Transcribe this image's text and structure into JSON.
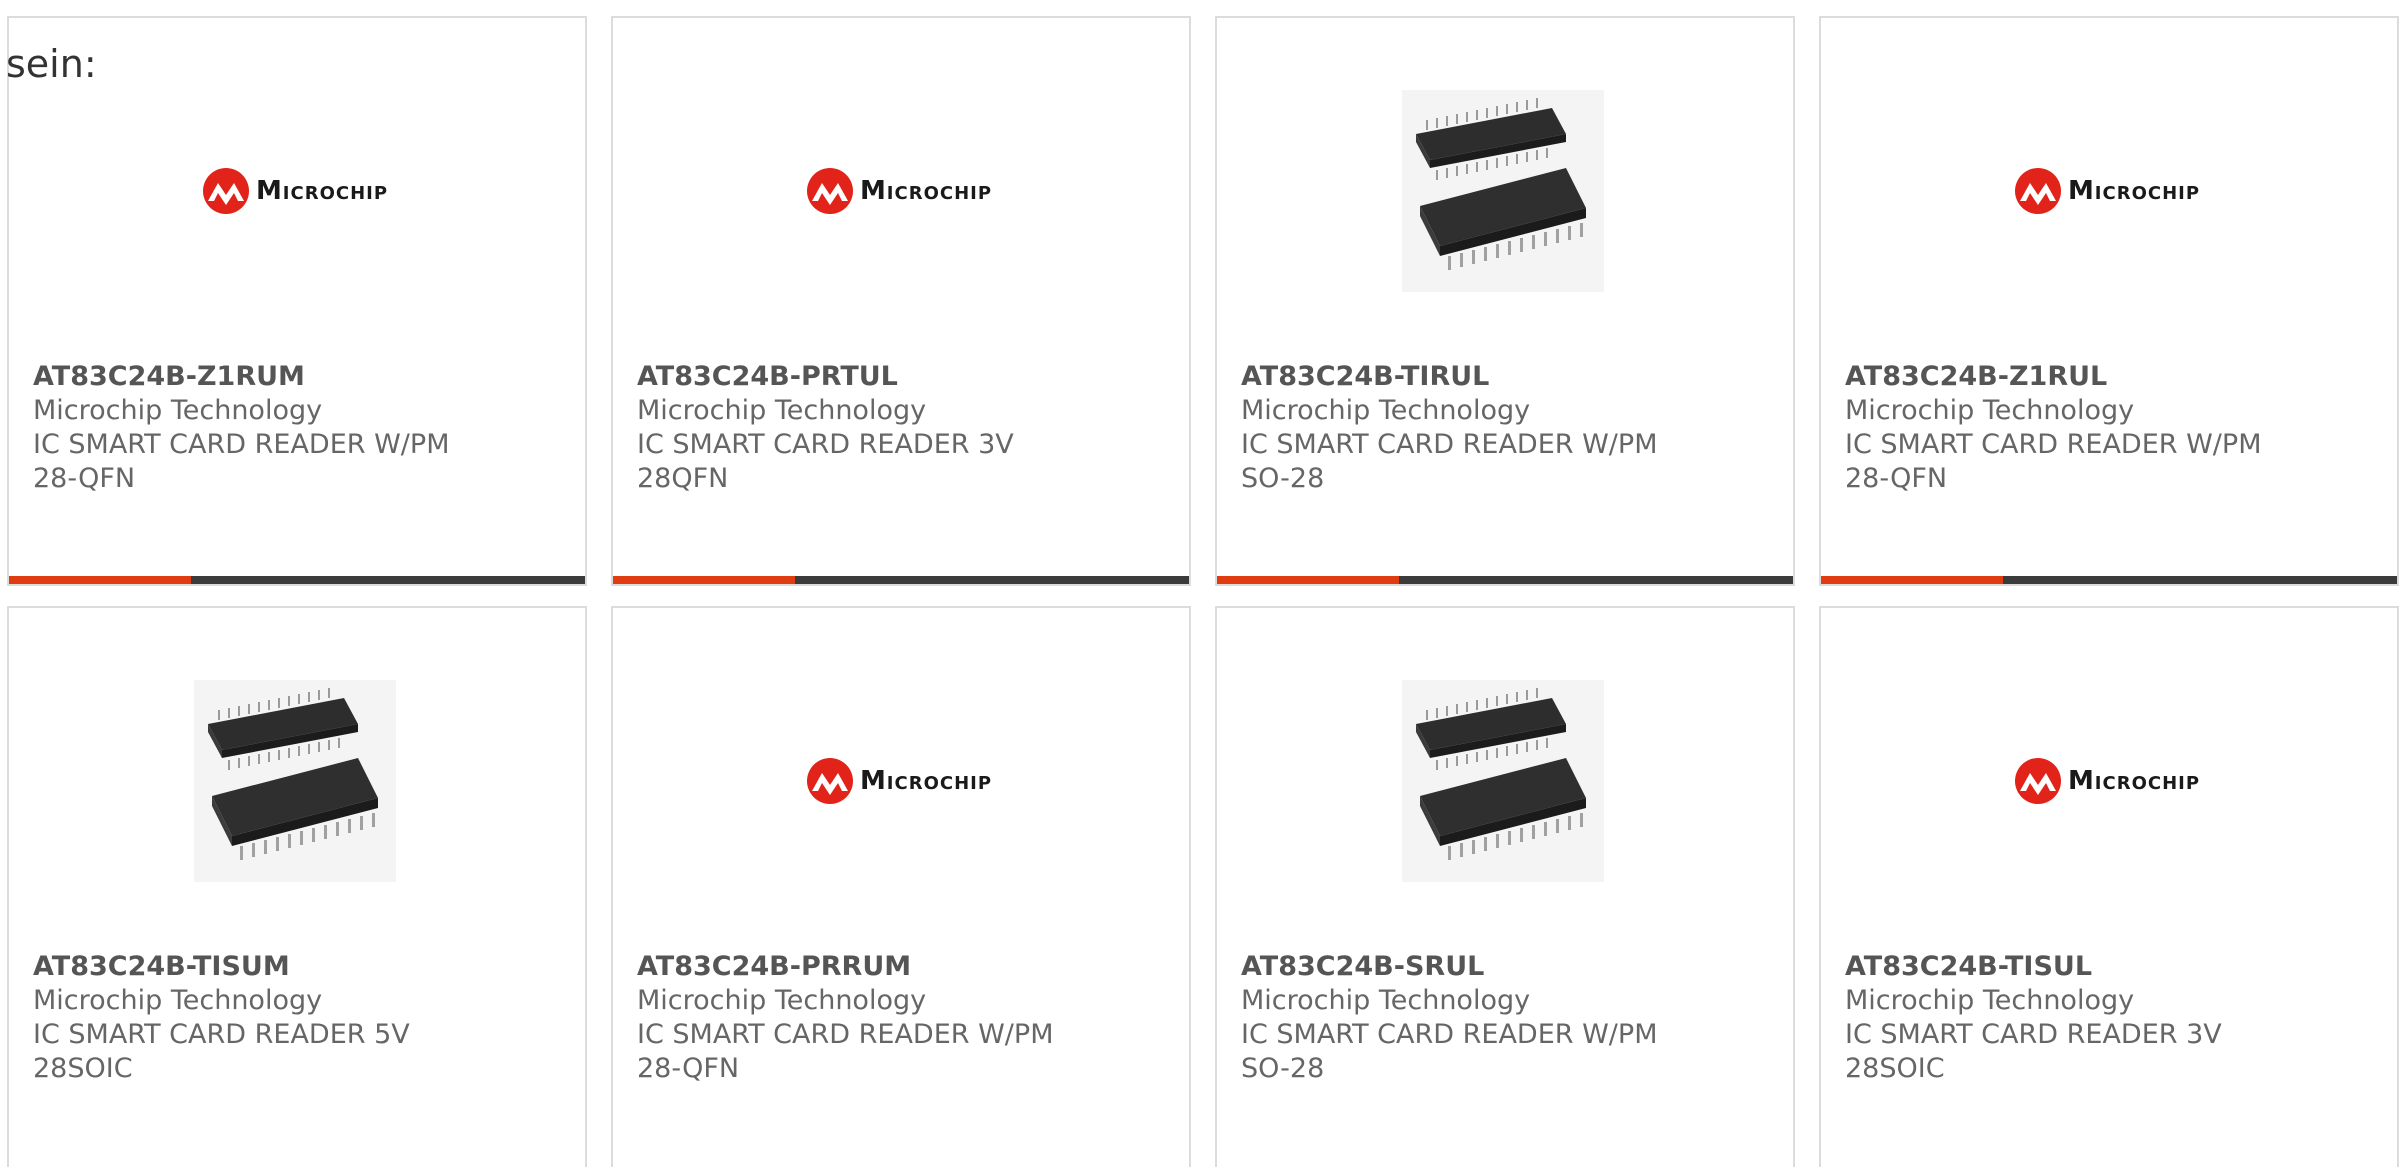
{
  "lead_text": "sein:",
  "logo_text": "Microchip",
  "colors": {
    "accent_bar": "#e03c12",
    "bar": "#3b3b3b",
    "logo_red": "#e2231a"
  },
  "cards": [
    {
      "part": "AT83C24B-Z1RUM",
      "manufacturer": "Microchip Technology",
      "description": "IC SMART CARD READER W/PM",
      "package": "28-QFN",
      "image": "microchip-logo"
    },
    {
      "part": "AT83C24B-PRTUL",
      "manufacturer": "Microchip Technology",
      "description": "IC SMART CARD READER 3V",
      "package": "28QFN",
      "image": "microchip-logo"
    },
    {
      "part": "AT83C24B-TIRUL",
      "manufacturer": "Microchip Technology",
      "description": "IC SMART CARD READER W/PM",
      "package": "SO-28",
      "image": "soic-chip"
    },
    {
      "part": "AT83C24B-Z1RUL",
      "manufacturer": "Microchip Technology",
      "description": "IC SMART CARD READER W/PM",
      "package": "28-QFN",
      "image": "microchip-logo"
    },
    {
      "part": "AT83C24B-TISUM",
      "manufacturer": "Microchip Technology",
      "description": "IC SMART CARD READER 5V",
      "package": "28SOIC",
      "image": "soic-chip"
    },
    {
      "part": "AT83C24B-PRRUM",
      "manufacturer": "Microchip Technology",
      "description": "IC SMART CARD READER W/PM",
      "package": "28-QFN",
      "image": "microchip-logo"
    },
    {
      "part": "AT83C24B-SRUL",
      "manufacturer": "Microchip Technology",
      "description": "IC SMART CARD READER W/PM",
      "package": "SO-28",
      "image": "soic-chip"
    },
    {
      "part": "AT83C24B-TISUL",
      "manufacturer": "Microchip Technology",
      "description": "IC SMART CARD READER 3V",
      "package": "28SOIC",
      "image": "microchip-logo"
    }
  ]
}
